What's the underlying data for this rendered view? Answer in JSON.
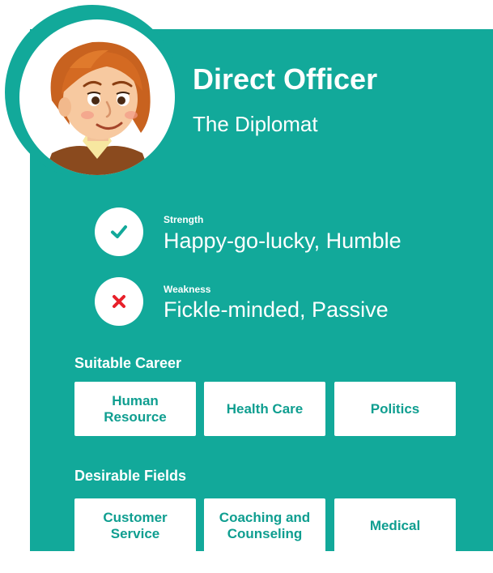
{
  "profile": {
    "name": "Direct Officer",
    "subtitle": "The Diplomat",
    "avatar_icon": "woman-avatar-illustration"
  },
  "traits": {
    "strength": {
      "label": "Strength",
      "value": "Happy-go-lucky, Humble",
      "icon": "check-icon",
      "icon_color": "#12a99a"
    },
    "weakness": {
      "label": "Weakness",
      "value": "Fickle-minded, Passive",
      "icon": "cross-icon",
      "icon_color": "#e8202a"
    }
  },
  "career": {
    "title": "Suitable Career",
    "items": [
      "Human Resource",
      "Health Care",
      "Politics"
    ]
  },
  "fields": {
    "title": "Desirable Fields",
    "items": [
      "Customer Service",
      "Coaching and Counseling",
      "Medical"
    ]
  },
  "colors": {
    "accent": "#12a99a",
    "chip_text": "#0f9e90",
    "white": "#ffffff"
  }
}
